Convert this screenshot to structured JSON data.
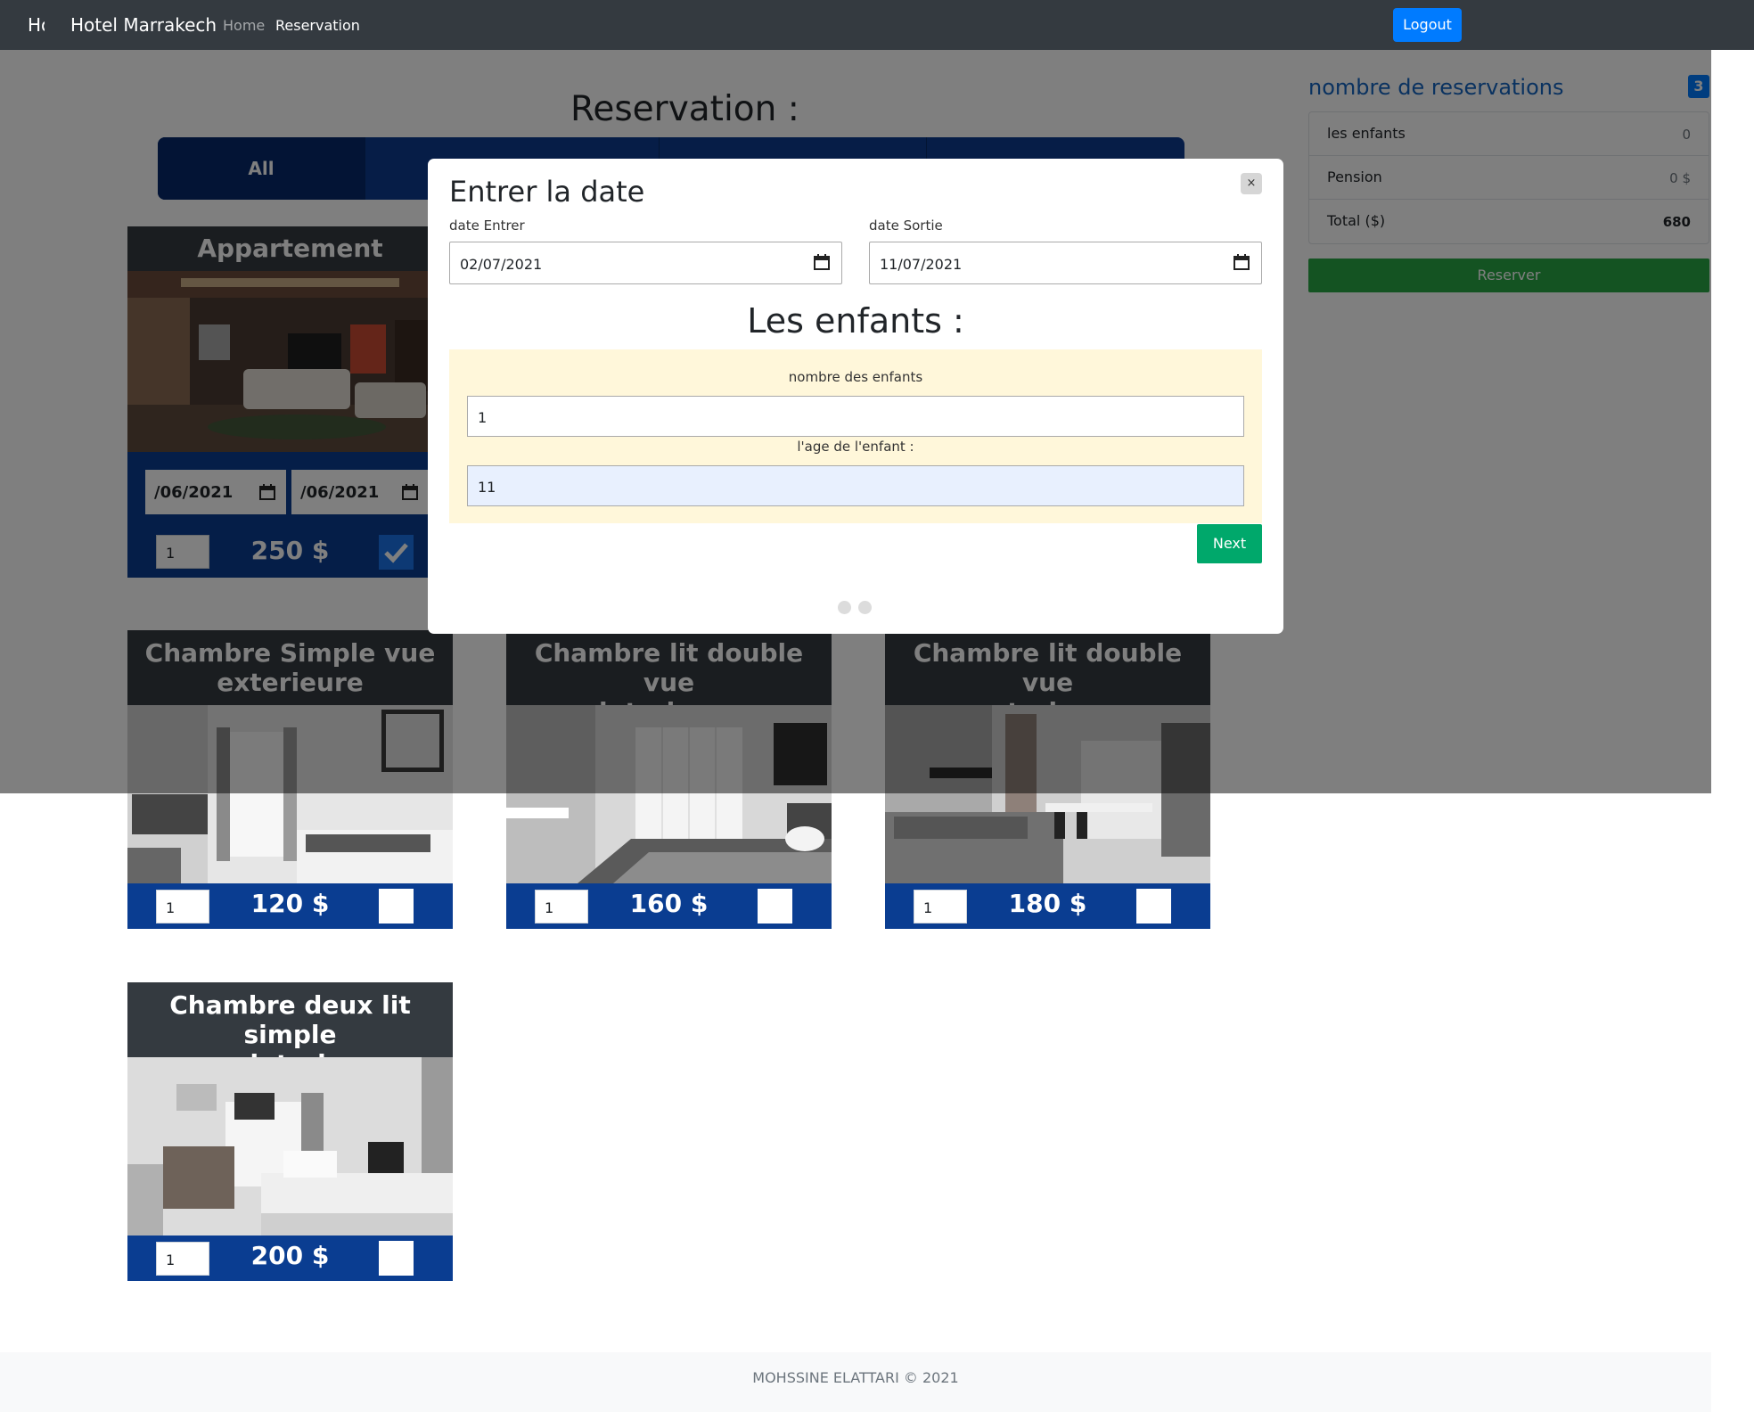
{
  "navbar": {
    "brand_short": "Hotel",
    "brand": "Hotel Marrakech",
    "links": [
      "Home",
      "Reservation"
    ],
    "logout": "Logout"
  },
  "main": {
    "title": "Reservation :",
    "filter_tabs": [
      "All",
      "",
      "",
      ""
    ],
    "appartement": {
      "title": "Appartement",
      "date_start": "/06/2021",
      "date_end": "/06/2021",
      "qty": "1",
      "price": "250 $",
      "checked": true
    },
    "rooms": [
      {
        "title_line1": "Chambre Simple vue",
        "title_line2": "exterieure",
        "qty": "1",
        "price": "120 $"
      },
      {
        "title_line1": "Chambre lit double vue",
        "title_line2": "interieure",
        "qty": "1",
        "price": "160 $"
      },
      {
        "title_line1": "Chambre lit double vue",
        "title_line2": "exterieure",
        "qty": "1",
        "price": "180 $"
      },
      {
        "title_line1": "Chambre deux lit simple",
        "title_line2": "vue interieure",
        "qty": "1",
        "price": "200 $"
      }
    ]
  },
  "sidebar": {
    "heading": "nombre de reservations",
    "badge": "3",
    "rows": [
      {
        "label": "les enfants",
        "value": "0"
      },
      {
        "label": "Pension",
        "value": "0 $"
      },
      {
        "label": "Total ($)",
        "value": "680"
      }
    ],
    "reserve_button": "Reserver"
  },
  "modal": {
    "title": "Entrer la date",
    "close": "×",
    "date_in_label": "date Entrer",
    "date_in_value": "02/07/2021",
    "date_out_label": "date Sortie",
    "date_out_value": "11/07/2021",
    "children_title": "Les enfants :",
    "children_count_label": "nombre des enfants",
    "children_count_value": "1",
    "child_age_label": "l'age de l'enfant :",
    "child_age_value": "11",
    "next_button": "Next",
    "pager_dots": 2
  },
  "footer": {
    "text": "MOHSSINE ELATTARI © 2021"
  },
  "colors": {
    "navbar": "#343a40",
    "primary": "#007bff",
    "card_blue": "#0a3d91",
    "success": "#28a745",
    "next": "#00a86b",
    "kid_box": "#fff7da"
  }
}
